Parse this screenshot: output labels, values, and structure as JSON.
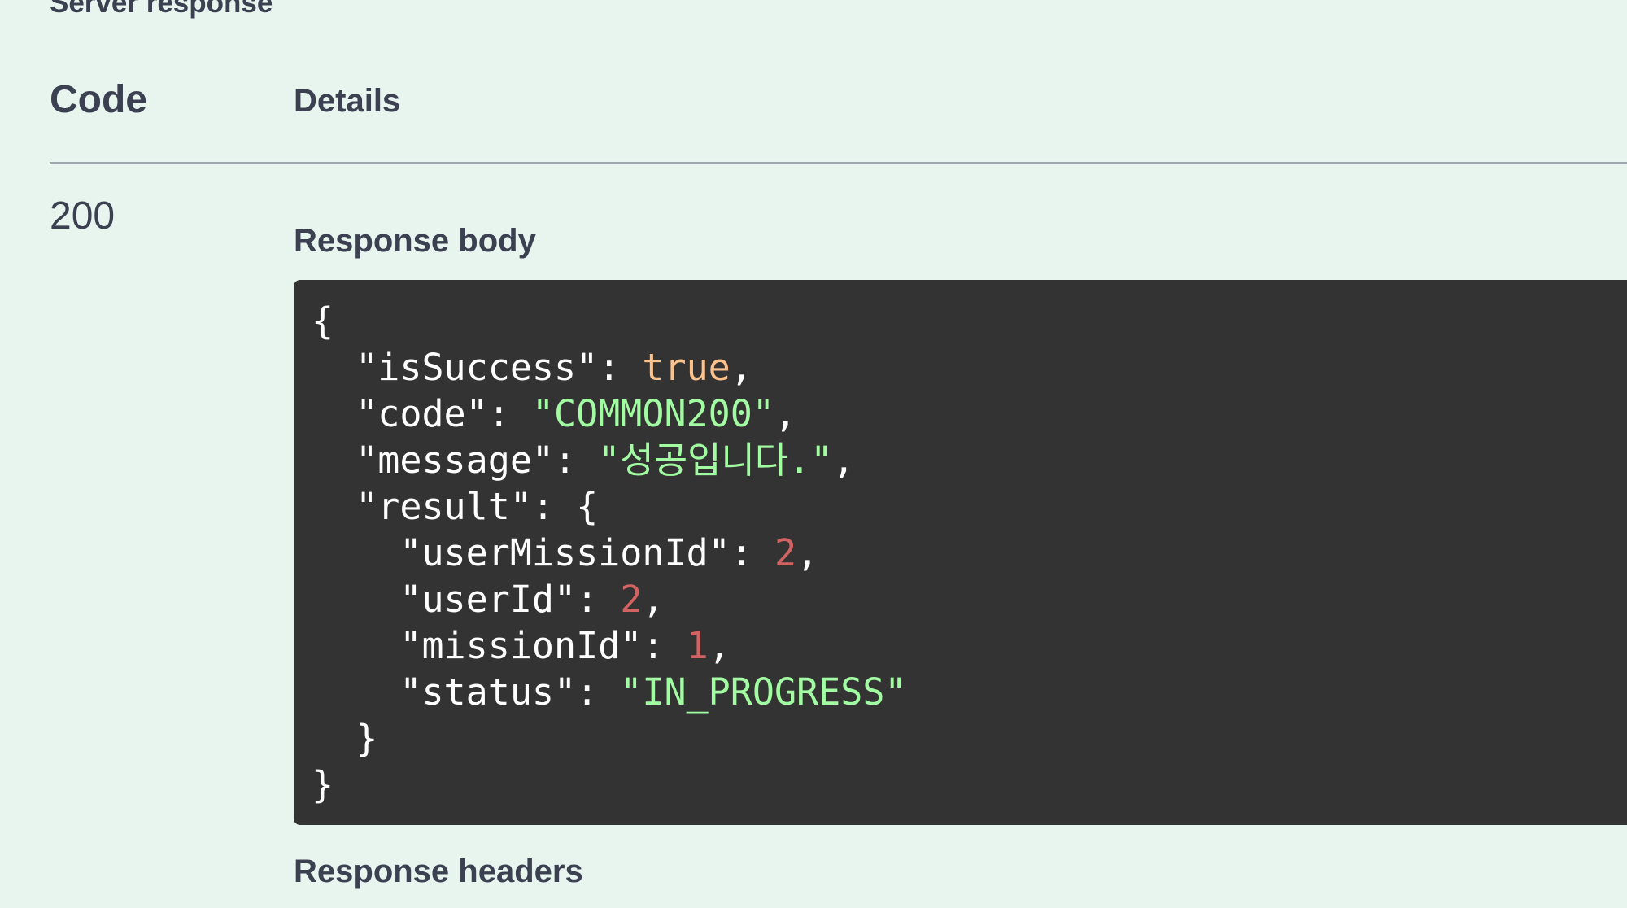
{
  "section": {
    "title": "Server response"
  },
  "table": {
    "code_header": "Code",
    "details_header": "Details",
    "status_code": "200"
  },
  "response_body": {
    "label": "Response body",
    "json_lines": [
      {
        "indent": "",
        "key": "",
        "sep": "",
        "value": "",
        "value_type": "",
        "suffix": "{"
      },
      {
        "indent": "  ",
        "key": "\"isSuccess\"",
        "sep": ": ",
        "value": "true",
        "value_type": "bool",
        "suffix": ","
      },
      {
        "indent": "  ",
        "key": "\"code\"",
        "sep": ": ",
        "value": "\"COMMON200\"",
        "value_type": "str",
        "suffix": ","
      },
      {
        "indent": "  ",
        "key": "\"message\"",
        "sep": ": ",
        "value": "\"성공입니다.\"",
        "value_type": "str",
        "suffix": ","
      },
      {
        "indent": "  ",
        "key": "\"result\"",
        "sep": ": ",
        "value": "",
        "value_type": "",
        "suffix": "{"
      },
      {
        "indent": "    ",
        "key": "\"userMissionId\"",
        "sep": ": ",
        "value": "2",
        "value_type": "num",
        "suffix": ","
      },
      {
        "indent": "    ",
        "key": "\"userId\"",
        "sep": ": ",
        "value": "2",
        "value_type": "num",
        "suffix": ","
      },
      {
        "indent": "    ",
        "key": "\"missionId\"",
        "sep": ": ",
        "value": "1",
        "value_type": "num",
        "suffix": ","
      },
      {
        "indent": "    ",
        "key": "\"status\"",
        "sep": ": ",
        "value": "\"IN_PROGRESS\"",
        "value_type": "str",
        "suffix": ""
      },
      {
        "indent": "  ",
        "key": "",
        "sep": "",
        "value": "",
        "value_type": "",
        "suffix": "}"
      },
      {
        "indent": "",
        "key": "",
        "sep": "",
        "value": "",
        "value_type": "",
        "suffix": "}"
      }
    ]
  },
  "response_headers": {
    "label": "Response headers"
  },
  "colors": {
    "background": "#e8f5ef",
    "code_bg": "#333333",
    "bool": "#fcc28c",
    "string": "#a2fca2",
    "number": "#d36363",
    "text": "#3b4151"
  }
}
